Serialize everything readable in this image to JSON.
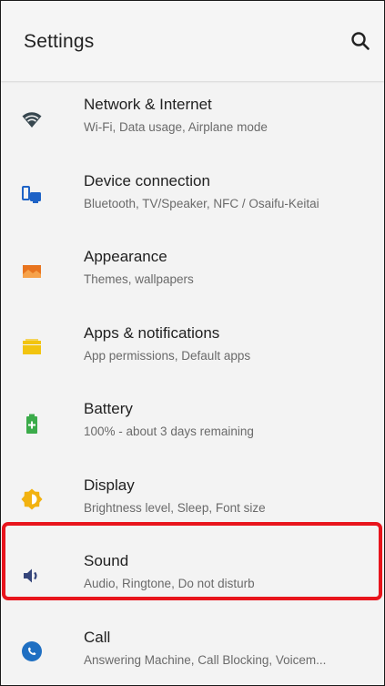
{
  "appbar": {
    "title": "Settings",
    "search_icon": "search-icon"
  },
  "settings_items": [
    {
      "key": "network",
      "title": "Network & Internet",
      "summary": "Wi-Fi, Data usage, Airplane mode",
      "icon": "wifi-icon",
      "color": "#37474f"
    },
    {
      "key": "device",
      "title": "Device connection",
      "summary": "Bluetooth, TV/Speaker, NFC / Osaifu-Keitai",
      "icon": "device-connection-icon",
      "color": "#1e63c6"
    },
    {
      "key": "appearance",
      "title": "Appearance",
      "summary": "Themes, wallpapers",
      "icon": "wallpaper-icon",
      "color": "#e8741e"
    },
    {
      "key": "apps",
      "title": "Apps & notifications",
      "summary": "App permissions, Default apps",
      "icon": "apps-icon",
      "color": "#f2c40f"
    },
    {
      "key": "battery",
      "title": "Battery",
      "summary": "100% - about 3 days remaining",
      "icon": "battery-icon",
      "color": "#3bab4a"
    },
    {
      "key": "display",
      "title": "Display",
      "summary": "Brightness level, Sleep, Font size",
      "icon": "brightness-icon",
      "color": "#f2b20f"
    },
    {
      "key": "sound",
      "title": "Sound",
      "summary": "Audio, Ringtone, Do not disturb",
      "icon": "volume-icon",
      "color": "#35457a"
    },
    {
      "key": "call",
      "title": "Call",
      "summary": "Answering Machine, Call Blocking, Voicem...",
      "icon": "call-icon",
      "color": "#1f6fc2"
    }
  ],
  "colors": {
    "highlight": "#e8141c",
    "background": "#f3f3f3"
  }
}
